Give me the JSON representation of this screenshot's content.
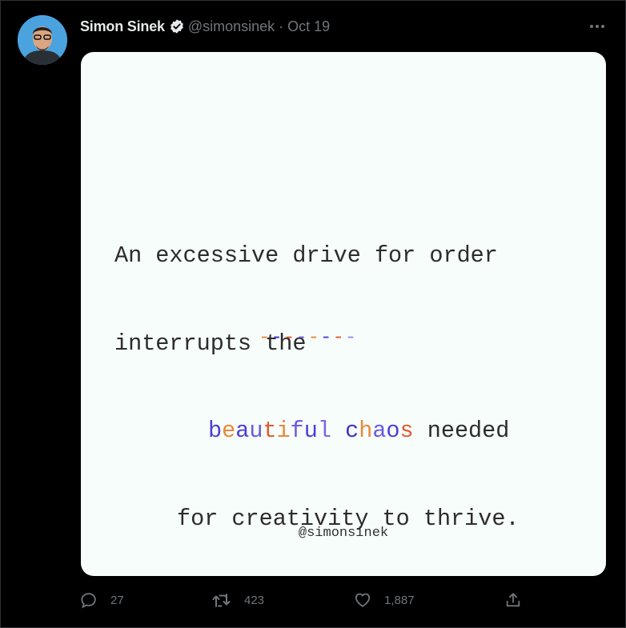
{
  "tweet": {
    "author_name": "Simon Sinek",
    "handle": "@simonsinek",
    "separator": "·",
    "date": "Oct 19",
    "more_icon": "more-horizontal-icon",
    "verified_icon": "verified-badge-icon"
  },
  "image": {
    "line1": "An excessive drive for order",
    "line2": "interrupts the",
    "line3_word1": "beautiful",
    "line3_word2": "chaos",
    "line3_rest": "needed",
    "line4": "for creativity to thrive.",
    "word1_colors": [
      "#4b3fd6",
      "#e8893a",
      "#4b3fd6",
      "#6b5ae0",
      "#e05a30",
      "#e8893a",
      "#6b5ae0",
      "#4b3fd6",
      "#7b63e6"
    ],
    "word2_colors": [
      "#3c31c8",
      "#e8893a",
      "#6b5ae0",
      "#4b3fd6",
      "#e05a30"
    ],
    "dashes": "--------",
    "dash_colors": [
      "#e8893a",
      "#3c31c8",
      "#e05a30",
      "#6b5ae0",
      "#e8893a",
      "#4b3fd6",
      "#e05a30",
      "#9a8cf0"
    ],
    "credit": "@simonsinek"
  },
  "actions": {
    "reply_count": "27",
    "retweet_count": "423",
    "like_count": "1,887",
    "reply_icon": "reply-icon",
    "retweet_icon": "retweet-icon",
    "like_icon": "heart-icon",
    "share_icon": "share-icon"
  }
}
